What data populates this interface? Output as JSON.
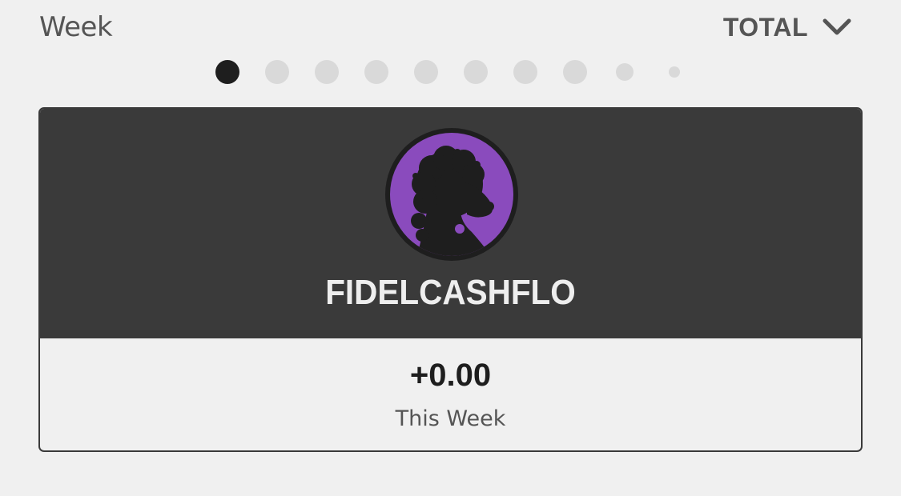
{
  "header": {
    "period_label": "Week",
    "scope_label": "TOTAL",
    "scope_icon": "chevron-down-icon"
  },
  "pager": {
    "page_count": 10,
    "active_index": 0
  },
  "card": {
    "avatar_icon": "poodle-silhouette-avatar",
    "avatar_color": "#8a4bbd",
    "username": "FIDELCASHFLO",
    "score": "+0.00",
    "score_period": "This Week"
  },
  "colors": {
    "background": "#f0f0f0",
    "card_header": "#3a3a3a",
    "dot_active": "#1e1e1e",
    "dot_inactive": "#d9d9d9"
  }
}
